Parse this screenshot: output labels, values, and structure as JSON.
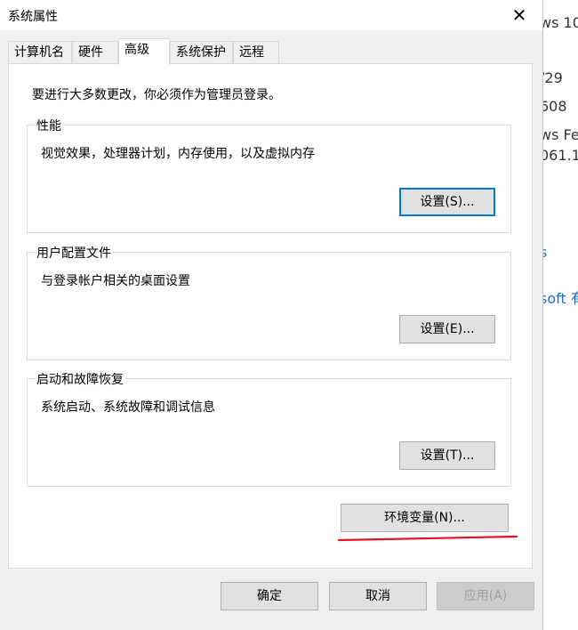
{
  "background_window": {
    "lines": [
      "ws 10",
      "/29",
      "608",
      "ws Fe",
      "061.1",
      "s",
      "soft 有"
    ]
  },
  "dialog": {
    "title": "系统属性",
    "close_glyph": "✕",
    "tabs": [
      {
        "label": "计算机名"
      },
      {
        "label": "硬件"
      },
      {
        "label": "高级"
      },
      {
        "label": "系统保护"
      },
      {
        "label": "远程"
      }
    ],
    "active_tab": "高级",
    "admin_note": "要进行大多数更改，你必须作为管理员登录。",
    "groups": [
      {
        "label": "性能",
        "desc": "视觉效果，处理器计划，内存使用，以及虚拟内存",
        "button": "设置(S)..."
      },
      {
        "label": "用户配置文件",
        "desc": "与登录帐户相关的桌面设置",
        "button": "设置(E)..."
      },
      {
        "label": "启动和故障恢复",
        "desc": "系统启动、系统故障和调试信息",
        "button": "设置(T)..."
      }
    ],
    "env_button": "环境变量(N)...",
    "footer": {
      "ok": "确定",
      "cancel": "取消",
      "apply": "应用(A)"
    }
  },
  "colors": {
    "accent": "#0078d7",
    "annotation": "#e81123",
    "link": "#1a6fd1"
  }
}
